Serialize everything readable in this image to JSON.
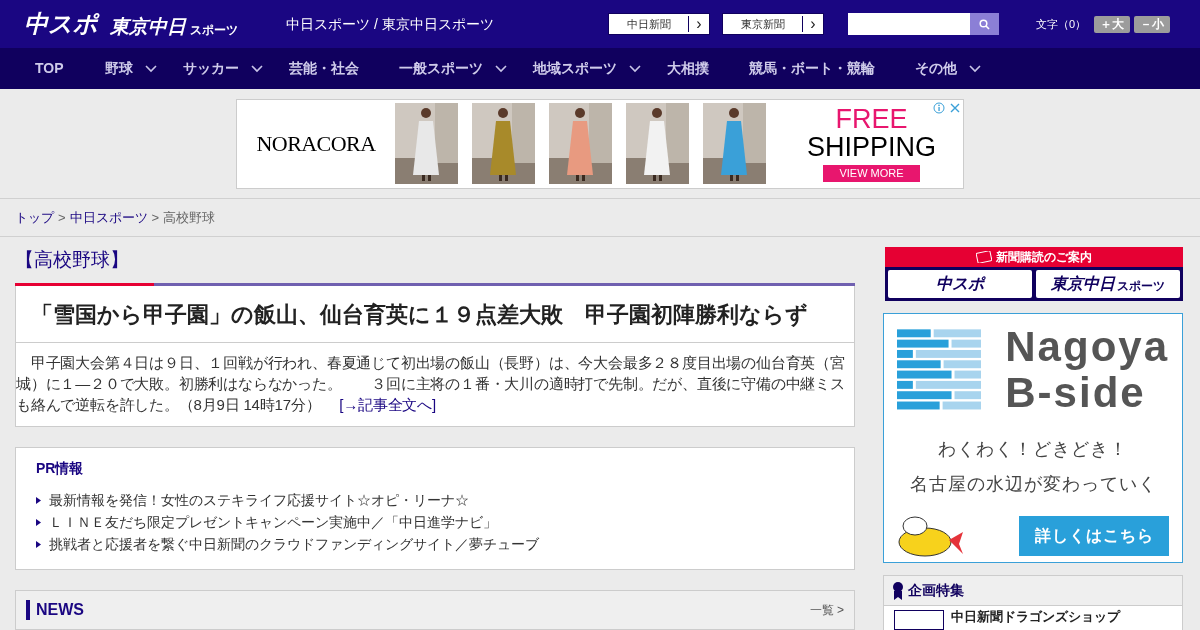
{
  "header": {
    "logo_main": "中スポ",
    "logo_tokyo": "東京中日",
    "logo_tokyo_sub": "スポーツ",
    "site_title": "中日スポーツ / 東京中日スポーツ",
    "site_links": [
      {
        "label": "中日新聞",
        "arrow": "›"
      },
      {
        "label": "東京新聞",
        "arrow": "›"
      }
    ],
    "font_size": {
      "label": "文字（0）",
      "buttons": [
        "＋大",
        "－小"
      ]
    }
  },
  "nav": [
    {
      "label": "TOP",
      "dropdown": false
    },
    {
      "label": "野球",
      "dropdown": true
    },
    {
      "label": "サッカー",
      "dropdown": true
    },
    {
      "label": "芸能・社会",
      "dropdown": false
    },
    {
      "label": "一般スポーツ",
      "dropdown": true
    },
    {
      "label": "地域スポーツ",
      "dropdown": true
    },
    {
      "label": "大相撲",
      "dropdown": false
    },
    {
      "label": "競馬・ボート・競輪",
      "dropdown": false
    },
    {
      "label": "その他",
      "dropdown": true
    }
  ],
  "ad": {
    "brand": "NORACORA",
    "headline_1": "FREE",
    "headline_2": "SHIPPING",
    "button": "VIEW MORE"
  },
  "breadcrumb": [
    {
      "label": "トップ",
      "link": true
    },
    {
      "separator": ">"
    },
    {
      "label": "中日スポーツ",
      "link": true
    },
    {
      "separator": ">"
    },
    {
      "label": "高校野球",
      "link": false
    }
  ],
  "category": "【高校野球】",
  "article": {
    "headline": "「雪国から甲子園」の飯山、仙台育英に１９点差大敗　甲子園初陣勝利ならず",
    "body": "　甲子園大会第４日は９日、１回戦が行われ、春夏通じて初出場の飯山（長野）は、今大会最多２８度目出場の仙台育英（宮城）に１―２０で大敗。初勝利はならなかった。　　３回に主将の１番・大川の適時打で先制。だが、直後に守備の中継ミスも絡んで逆転を許した。（8月9日 14時17分）",
    "more_link": "[→記事全文へ]"
  },
  "pr": {
    "title": "PR情報",
    "items": [
      "最新情報を発信！女性のステキライフ応援サイト☆オピ・リーナ☆",
      "ＬＩＮＥ友だち限定プレゼントキャンペーン実施中／「中日進学ナビ」",
      "挑戦者と応援者を繋ぐ中日新聞のクラウドファンディングサイト／夢チューブ"
    ]
  },
  "news": {
    "title": "NEWS",
    "more": "一覧 >"
  },
  "sidebar": {
    "subscribe": {
      "title": "新聞購読のご案内",
      "buttons": [
        "中スポ",
        "東京中日"
      ],
      "sub": "スポーツ"
    },
    "banner": {
      "title_1": "Nagoya",
      "title_2": "B-side",
      "line_1": "わくわく！どきどき！",
      "line_2": "名古屋の水辺が変わっていく",
      "button": "詳しくはこちら"
    },
    "features": {
      "title": "企画特集",
      "items": [
        "中日新聞ドラゴンズショップ"
      ]
    }
  }
}
